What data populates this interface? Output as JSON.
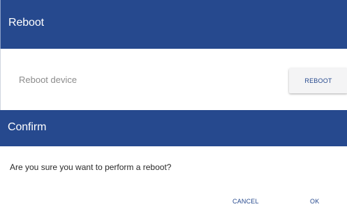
{
  "reboot_panel": {
    "title": "Reboot",
    "setting_label": "Reboot device",
    "button_label": "REBOOT"
  },
  "confirm_dialog": {
    "title": "Confirm",
    "message": "Are you sure you want to perform a reboot?",
    "cancel_label": "CANCEL",
    "ok_label": "OK"
  },
  "colors": {
    "header_blue": "#26498e",
    "button_text_blue": "#26498e",
    "label_gray": "#8c8c8c",
    "message_text": "#2a2a2a"
  }
}
